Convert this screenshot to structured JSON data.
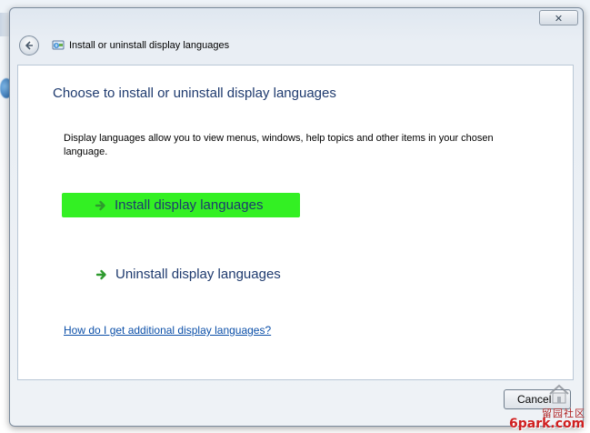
{
  "window": {
    "title": "Install or uninstall display languages",
    "close_glyph": "✕"
  },
  "content": {
    "heading": "Choose to install or uninstall display languages",
    "description": "Display languages allow you to view menus, windows, help topics and other items in your chosen language.",
    "commands": [
      {
        "label": "Install display languages",
        "icon": "green-arrow-icon",
        "highlighted": true
      },
      {
        "label": "Uninstall display languages",
        "icon": "green-arrow-icon",
        "highlighted": false
      }
    ],
    "help_link": "How do I get additional display languages?"
  },
  "footer": {
    "cancel_label": "Cancel"
  },
  "watermark": {
    "cn_text": "留园社区",
    "brand": "6park.com"
  },
  "colors": {
    "highlight": "#33f023",
    "heading": "#1e3a6e",
    "link": "#0b4fa8",
    "arrow": "#2e9a2e"
  }
}
